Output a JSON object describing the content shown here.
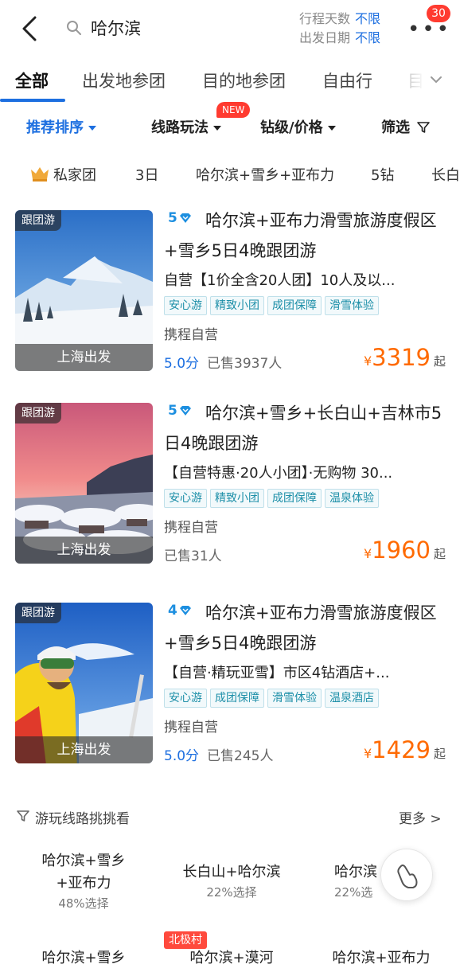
{
  "header": {
    "search_text": "哈尔滨",
    "trip_days_label": "行程天数",
    "trip_days_value": "不限",
    "depart_date_label": "出发日期",
    "depart_date_value": "不限",
    "notif_count": "30"
  },
  "tabs": [
    "全部",
    "出发地参团",
    "目的地参团",
    "自由行",
    "目"
  ],
  "sort": {
    "recommended": "推荐排序",
    "route_play": "线路玩法",
    "new_badge": "NEW",
    "level_price": "钻级/价格",
    "filter": "筛选"
  },
  "chips": [
    "私家团",
    "3日",
    "哈尔滨+雪乡+亚布力",
    "5钻",
    "长白"
  ],
  "products": [
    {
      "tag": "跟团游",
      "depart": "上海出发",
      "diamond": "5",
      "title": "哈尔滨+亚布力滑雪旅游度假区+雪乡5日4晚跟团游",
      "desc": "自营【1价全含20人团】10人及以...",
      "tags": [
        "安心游",
        "精致小团",
        "成团保障",
        "滑雪体验"
      ],
      "seller": "携程自营",
      "score": "5.0分",
      "sold": "已售3937人",
      "price": "3319",
      "price_suffix": "起"
    },
    {
      "tag": "跟团游",
      "depart": "上海出发",
      "diamond": "5",
      "title": "哈尔滨+雪乡+长白山+吉林市5日4晚跟团游",
      "desc": "【自营特惠·20人小团】·无购物 30...",
      "tags": [
        "安心游",
        "精致小团",
        "成团保障",
        "温泉体验"
      ],
      "seller": "携程自营",
      "score": "",
      "sold": "已售31人",
      "price": "1960",
      "price_suffix": "起"
    },
    {
      "tag": "跟团游",
      "depart": "上海出发",
      "diamond": "4",
      "title": "哈尔滨+亚布力滑雪旅游度假区+雪乡5日4晚跟团游",
      "desc": "【自营·精玩亚雪】市区4钻酒店+...",
      "tags": [
        "安心游",
        "成团保障",
        "滑雪体验",
        "温泉酒店"
      ],
      "seller": "携程自营",
      "score": "5.0分",
      "sold": "已售245人",
      "price": "1429",
      "price_suffix": "起"
    }
  ],
  "routes": {
    "title": "游玩线路挑挑看",
    "more": "更多 >",
    "items": [
      {
        "line1": "哈尔滨+雪乡",
        "line2": "+亚布力",
        "pct": "48%选择"
      },
      {
        "line1": "长白山+哈尔滨",
        "line2": "",
        "pct": "22%选择"
      },
      {
        "line1": "哈尔滨",
        "line2": "",
        "pct": "22%选"
      }
    ],
    "row2": [
      "哈尔滨+雪乡",
      "哈尔滨+漠河",
      "哈尔滨+亚布力"
    ],
    "row2_badge": "北极村"
  },
  "colors": {
    "accent": "#1d6fe0",
    "price": "#ff6a00",
    "badge": "#ff3b30"
  }
}
